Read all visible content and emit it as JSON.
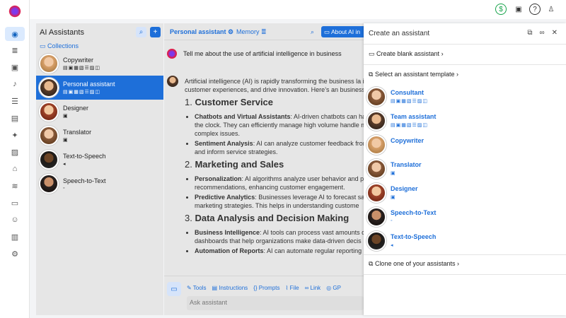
{
  "rail": {
    "icons": [
      "app-logo",
      "assistants-icon",
      "database-icon",
      "gallery-icon",
      "microphone-icon",
      "tasks-icon",
      "documents-icon",
      "sparkle-icon",
      "image-icon",
      "library-icon",
      "stack-icon",
      "chat-icon",
      "users-icon",
      "server-icon",
      "settings-icon"
    ]
  },
  "topbar": {
    "icons": [
      "dollar-icon",
      "robot-icon",
      "help-icon",
      "user-icon"
    ]
  },
  "left": {
    "title": "AI Assistants",
    "collections": "Collections",
    "items": [
      {
        "name": "Copywriter",
        "icons": "▤▣▦▧☰▨◫"
      },
      {
        "name": "Personal assistant",
        "icons": "▤▣▦▧☰▨◫"
      },
      {
        "name": "Designer",
        "icons": "▣"
      },
      {
        "name": "Translator",
        "icons": "▣"
      },
      {
        "name": "Text-to-Speech",
        "icons": "◂"
      },
      {
        "name": "Speech-to-Text",
        "icons": "◦"
      }
    ]
  },
  "chat": {
    "tab_personal": "Personal assistant",
    "tab_memory": "Memory",
    "about": "About AI in",
    "user_msg": "Tell me about the use of artificial intelligence in business",
    "intro": "Artificial intelligence (AI) is rapidly transforming the business la improve customer experiences, and drive innovation. Here’s an businesses:",
    "s1": "1. ",
    "s1b": "Customer Service",
    "s1i1b": "Chatbots and Virtual Assistants",
    "s1i1": ": AI-driven chatbots can ha around the clock. They can efficiently manage high volume handle more complex issues.",
    "s1i2b": "Sentiment Analysis",
    "s1i2": ": AI can analyze customer feedback fron sentiment and inform service strategies.",
    "s2": "2. ",
    "s2b": "Marketing and Sales",
    "s2i1b": "Personalization",
    "s2i1": ": AI algorithms analyze user behavior and p recommendations, enhancing customer engagement.",
    "s2i2b": "Predictive Analytics",
    "s2i2": ": Businesses leverage AI to forecast sale marketing strategies. This helps in understanding custome",
    "s3": "3. ",
    "s3b": "Data Analysis and Decision Making",
    "s3i1b": "Business Intelligence",
    "s3i1": ": AI tools can process vast amounts o dashboards that help organizations make data-driven decis",
    "s3i2b": "Automation of Reports",
    "s3i2": ": AI can automate regular reporting",
    "tools": [
      "Tools",
      "Instructions",
      "Prompts",
      "File",
      "Link",
      "GP"
    ],
    "ask_placeholder": "Ask assistant"
  },
  "panel": {
    "title": "Create an assistant",
    "blank": "Create blank assistant",
    "template": "Select an assistant template",
    "clone": "Clone one of your assistants",
    "templates": [
      {
        "name": "Consultant",
        "icons": "▤▣▦▧☰▨◫"
      },
      {
        "name": "Team assistant",
        "icons": "▤▣▦▧☰▨◫"
      },
      {
        "name": "Copywriter",
        "icons": ""
      },
      {
        "name": "Translator",
        "icons": "▣"
      },
      {
        "name": "Designer",
        "icons": "▣"
      },
      {
        "name": "Speech-to-Text",
        "icons": "◦"
      },
      {
        "name": "Text-to-Speech",
        "icons": "◂"
      }
    ]
  }
}
